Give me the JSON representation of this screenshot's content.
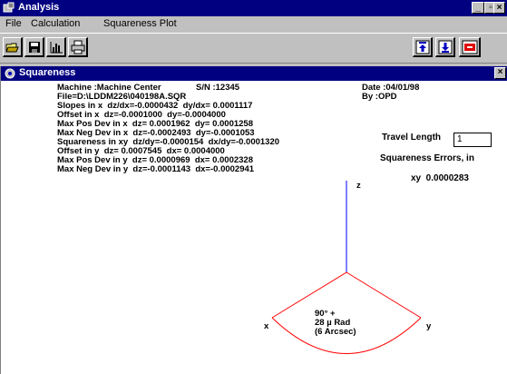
{
  "window": {
    "title": "Analysis"
  },
  "menu": [
    {
      "label": "File",
      "accel": "F"
    },
    {
      "label": "Calculation",
      "accel": "C"
    },
    {
      "label": "Squareness Plot",
      "accel": "P"
    }
  ],
  "child_window": {
    "title": "Squareness"
  },
  "report": {
    "machine": "Machine :Machine Center",
    "serial": "S/N :12345",
    "date": "Date :04/01/98",
    "file": "File=D:\\LDDM226\\040198A.SQR",
    "by": "By :OPD",
    "lines": [
      "Slopes in x  dz/dx=-0.0000432  dy/dx= 0.0001117",
      "Offset in x  dz=-0.0001000  dy=-0.0004000",
      "Max Pos Dev in x  dz= 0.0001962  dy= 0.0001258",
      "Max Neg Dev in x  dz=-0.0002493  dy=-0.0001053",
      "Squareness in xy  dz/dy=-0.0000154  dx/dy=-0.0001320",
      "Offset in y  dz= 0.0007545  dx= 0.0004000",
      "Max Pos Dev in y  dz= 0.0000969  dx= 0.0002328",
      "Max Neg Dev in y  dz=-0.0001143  dx=-0.0002941"
    ]
  },
  "travel": {
    "label": "Travel Length",
    "value": "1"
  },
  "squareness_errors": {
    "label": "Squareness Errors, in",
    "xy": "xy  0.0000283"
  },
  "plot": {
    "axis_z": "z",
    "axis_x": "x",
    "axis_y": "y",
    "angle_line1": "90° +",
    "angle_line2": "28 µ Rad",
    "angle_line3": "(6 Arcsec)",
    "colors": {
      "z_axis": "#0000ff",
      "xy_axes": "#ff0000"
    }
  },
  "icons": [
    "app-icon",
    "open-icon",
    "save-icon",
    "chart-icon",
    "print-icon",
    "upload-icon",
    "download-icon",
    "exit-icon"
  ]
}
